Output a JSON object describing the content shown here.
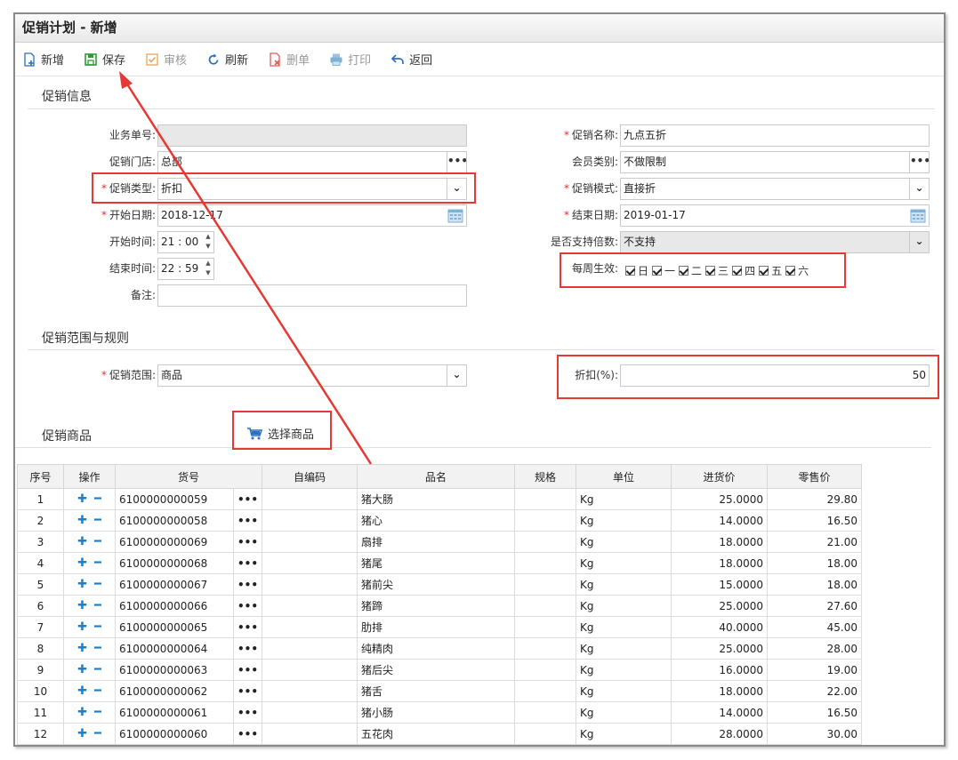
{
  "window": {
    "title": "促销计划 - 新增"
  },
  "toolbar": {
    "new": "新增",
    "save": "保存",
    "audit": "审核",
    "refresh": "刷新",
    "delete": "删单",
    "print": "打印",
    "back": "返回"
  },
  "sections": {
    "info": "促销信息",
    "scope": "促销范围与规则",
    "goods": "促销商品"
  },
  "form": {
    "doc_no_label": "业务单号:",
    "doc_no_value": "",
    "store_label": "促销门店:",
    "store_value": "总部",
    "type_label": "促销类型:",
    "type_value": "折扣",
    "start_date_label": "开始日期:",
    "start_date_value": "2018-12-17",
    "start_time_label": "开始时间:",
    "start_time_value": "21 : 00",
    "end_time_label": "结束时间:",
    "end_time_value": "22 : 59",
    "remark_label": "备注:",
    "remark_value": "",
    "name_label": "促销名称:",
    "name_value": "九点五折",
    "member_label": "会员类别:",
    "member_value": "不做限制",
    "mode_label": "促销模式:",
    "mode_value": "直接折",
    "end_date_label": "结束日期:",
    "end_date_value": "2019-01-17",
    "multiple_label": "是否支持倍数:",
    "multiple_value": "不支持",
    "weekly_label": "每周生效:",
    "weekdays": [
      "日",
      "一",
      "二",
      "三",
      "四",
      "五",
      "六"
    ],
    "range_label": "促销范围:",
    "range_value": "商品",
    "discount_label": "折扣(%):",
    "discount_value": "50"
  },
  "select_goods": "选择商品",
  "table": {
    "headers": [
      "序号",
      "操作",
      "货号",
      "自编码",
      "品名",
      "规格",
      "单位",
      "进货价",
      "零售价"
    ],
    "rows": [
      [
        "1",
        "6100000000059",
        "猪大肠",
        "Kg",
        "25.0000",
        "29.80"
      ],
      [
        "2",
        "6100000000058",
        "猪心",
        "Kg",
        "14.0000",
        "16.50"
      ],
      [
        "3",
        "6100000000069",
        "扇排",
        "Kg",
        "18.0000",
        "21.00"
      ],
      [
        "4",
        "6100000000068",
        "猪尾",
        "Kg",
        "18.0000",
        "18.00"
      ],
      [
        "5",
        "6100000000067",
        "猪前尖",
        "Kg",
        "15.0000",
        "18.00"
      ],
      [
        "6",
        "6100000000066",
        "猪蹄",
        "Kg",
        "25.0000",
        "27.60"
      ],
      [
        "7",
        "6100000000065",
        "肋排",
        "Kg",
        "40.0000",
        "45.00"
      ],
      [
        "8",
        "6100000000064",
        "纯精肉",
        "Kg",
        "25.0000",
        "28.00"
      ],
      [
        "9",
        "6100000000063",
        "猪后尖",
        "Kg",
        "16.0000",
        "19.00"
      ],
      [
        "10",
        "6100000000062",
        "猪舌",
        "Kg",
        "18.0000",
        "22.00"
      ],
      [
        "11",
        "6100000000061",
        "猪小肠",
        "Kg",
        "14.0000",
        "16.50"
      ],
      [
        "12",
        "6100000000060",
        "五花肉",
        "Kg",
        "28.0000",
        "30.00"
      ]
    ]
  },
  "colors": {
    "highlight": "#e53935",
    "accent": "#1a7fd0"
  }
}
